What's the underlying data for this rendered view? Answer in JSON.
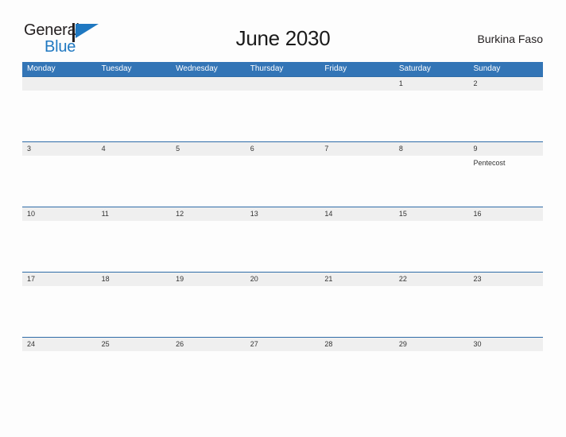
{
  "brand": {
    "name_part1": "General",
    "name_part2": "Blue",
    "flag_icon": "flag-triangle-icon",
    "accent_color": "#1f78c1",
    "dark_color": "#231f20"
  },
  "header": {
    "title": "June 2030",
    "region": "Burkina Faso"
  },
  "calendar": {
    "header_color": "#3375b6",
    "date_band_color": "#efefef",
    "weekdays": [
      "Monday",
      "Tuesday",
      "Wednesday",
      "Thursday",
      "Friday",
      "Saturday",
      "Sunday"
    ],
    "weeks": [
      {
        "dates": [
          "",
          "",
          "",
          "",
          "",
          "1",
          "2"
        ],
        "events": [
          "",
          "",
          "",
          "",
          "",
          "",
          ""
        ]
      },
      {
        "dates": [
          "3",
          "4",
          "5",
          "6",
          "7",
          "8",
          "9"
        ],
        "events": [
          "",
          "",
          "",
          "",
          "",
          "",
          "Pentecost"
        ]
      },
      {
        "dates": [
          "10",
          "11",
          "12",
          "13",
          "14",
          "15",
          "16"
        ],
        "events": [
          "",
          "",
          "",
          "",
          "",
          "",
          ""
        ]
      },
      {
        "dates": [
          "17",
          "18",
          "19",
          "20",
          "21",
          "22",
          "23"
        ],
        "events": [
          "",
          "",
          "",
          "",
          "",
          "",
          ""
        ]
      },
      {
        "dates": [
          "24",
          "25",
          "26",
          "27",
          "28",
          "29",
          "30"
        ],
        "events": [
          "",
          "",
          "",
          "",
          "",
          "",
          ""
        ]
      }
    ]
  }
}
